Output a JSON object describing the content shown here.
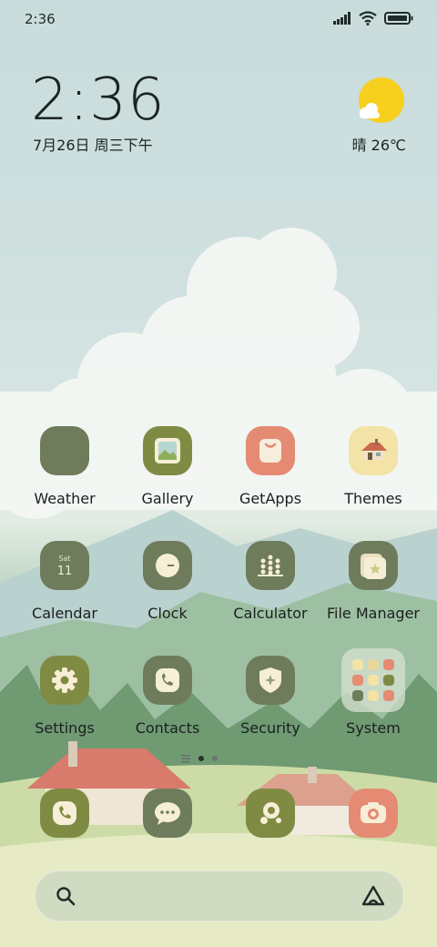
{
  "status_bar": {
    "time": "2:36"
  },
  "clock_widget": {
    "time": "2:36",
    "date": "7月26日 周三下午"
  },
  "weather_widget": {
    "condition": "晴",
    "temperature": "26℃"
  },
  "apps": [
    {
      "label": "Weather"
    },
    {
      "label": "Gallery"
    },
    {
      "label": "GetApps"
    },
    {
      "label": "Themes"
    },
    {
      "label": "Calendar",
      "icon_day": "Sat",
      "icon_date": "11"
    },
    {
      "label": "Clock"
    },
    {
      "label": "Calculator"
    },
    {
      "label": "File Manager"
    },
    {
      "label": "Settings"
    },
    {
      "label": "Contacts"
    },
    {
      "label": "Security"
    },
    {
      "label": "System"
    }
  ],
  "dock": [
    "phone-icon",
    "messages-icon",
    "browser-icon",
    "camera-icon"
  ],
  "colors": {
    "olive": "#7a8a4a",
    "sage": "#6e7c5c",
    "coral": "#e58a73",
    "cream": "#f3e3a6"
  }
}
